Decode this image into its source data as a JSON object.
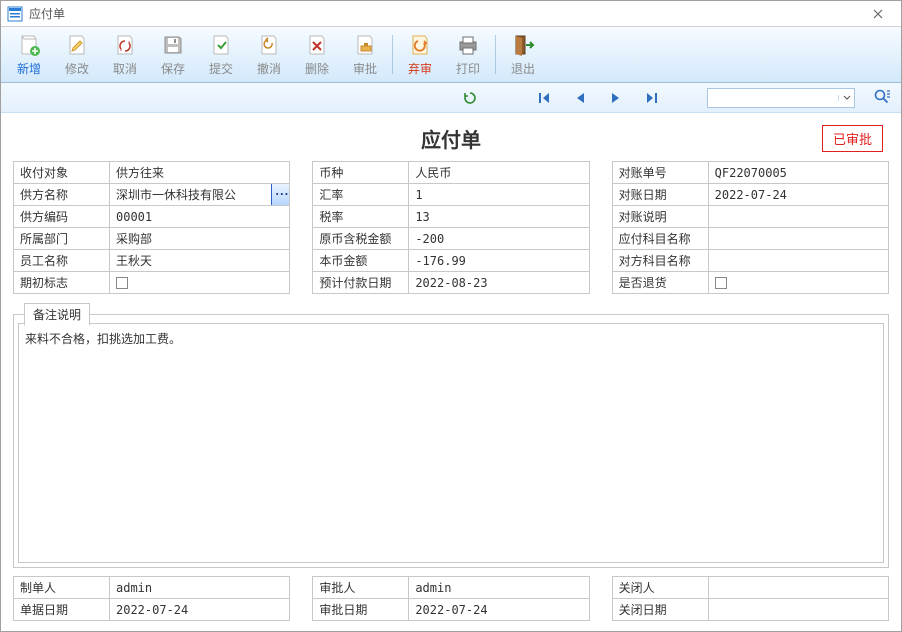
{
  "window": {
    "title": "应付单"
  },
  "toolbar": {
    "add": "新增",
    "edit": "修改",
    "cancel": "取消",
    "save": "保存",
    "submit": "提交",
    "undo": "撤消",
    "delete": "删除",
    "approve": "审批",
    "abandon": "弃审",
    "print": "打印",
    "exit": "退出"
  },
  "doc": {
    "title": "应付单",
    "approved_stamp": "已审批"
  },
  "left": {
    "payee_type_label": "收付对象",
    "payee_type": "供方往来",
    "supplier_name_label": "供方名称",
    "supplier_name": "深圳市一休科技有限公",
    "supplier_code_label": "供方编码",
    "supplier_code": "00001",
    "department_label": "所属部门",
    "department": "采购部",
    "employee_label": "员工名称",
    "employee": "王秋天",
    "initial_flag_label": "期初标志",
    "initial_flag": false
  },
  "mid": {
    "currency_label": "币种",
    "currency": "人民币",
    "rate_label": "汇率",
    "rate": "1",
    "tax_rate_label": "税率",
    "tax_rate": "13",
    "orig_amount_label": "原币含税金额",
    "orig_amount": "-200",
    "local_amount_label": "本币金额",
    "local_amount": "-176.99",
    "est_pay_date_label": "预计付款日期",
    "est_pay_date": "2022-08-23"
  },
  "right": {
    "recon_no_label": "对账单号",
    "recon_no": "QF22070005",
    "recon_date_label": "对账日期",
    "recon_date": "2022-07-24",
    "recon_desc_label": "对账说明",
    "recon_desc": "",
    "ap_subject_label": "应付科目名称",
    "ap_subject": "",
    "counter_subject_label": "对方科目名称",
    "counter_subject": "",
    "is_return_label": "是否退货",
    "is_return": false
  },
  "remarks": {
    "tab": "备注说明",
    "text": "来料不合格，扣挑选加工费。"
  },
  "footer": {
    "creator_label": "制单人",
    "creator": "admin",
    "doc_date_label": "单据日期",
    "doc_date": "2022-07-24",
    "approver_label": "审批人",
    "approver": "admin",
    "approve_date_label": "审批日期",
    "approve_date": "2022-07-24",
    "closer_label": "关闭人",
    "closer": "",
    "close_date_label": "关闭日期",
    "close_date": ""
  }
}
